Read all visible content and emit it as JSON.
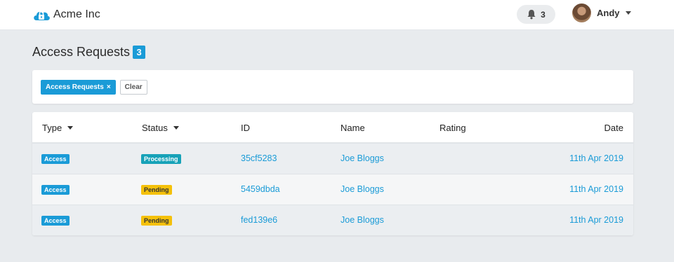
{
  "colors": {
    "accent": "#1a9bd7",
    "processing": "#17a2b8",
    "pending": "#f5c10a",
    "background": "#e8ebee"
  },
  "header": {
    "brand_icon": "cloud-lock-icon",
    "brand_name": "Acme Inc",
    "notifications": {
      "icon": "bell-icon",
      "count": "3"
    },
    "user": {
      "name": "Andy",
      "dropdown_icon": "chevron-down-icon"
    }
  },
  "page": {
    "title": "Access Requests",
    "count": "3"
  },
  "filters": {
    "active": [
      {
        "label": "Access Requests",
        "remove_icon": "×"
      }
    ],
    "clear_label": "Clear"
  },
  "table": {
    "columns": [
      {
        "label": "Type",
        "sortable": true
      },
      {
        "label": "Status",
        "sortable": true
      },
      {
        "label": "ID",
        "sortable": false
      },
      {
        "label": "Name",
        "sortable": false
      },
      {
        "label": "Rating",
        "sortable": false
      },
      {
        "label": "Date",
        "sortable": false
      }
    ],
    "rows": [
      {
        "type": "Access",
        "status": "Processing",
        "id": "35cf5283",
        "name": "Joe Bloggs",
        "rating": "",
        "date": "11th Apr 2019"
      },
      {
        "type": "Access",
        "status": "Pending",
        "id": "5459dbda",
        "name": "Joe Bloggs",
        "rating": "",
        "date": "11th Apr 2019"
      },
      {
        "type": "Access",
        "status": "Pending",
        "id": "fed139e6",
        "name": "Joe Bloggs",
        "rating": "",
        "date": "11th Apr 2019"
      }
    ]
  }
}
